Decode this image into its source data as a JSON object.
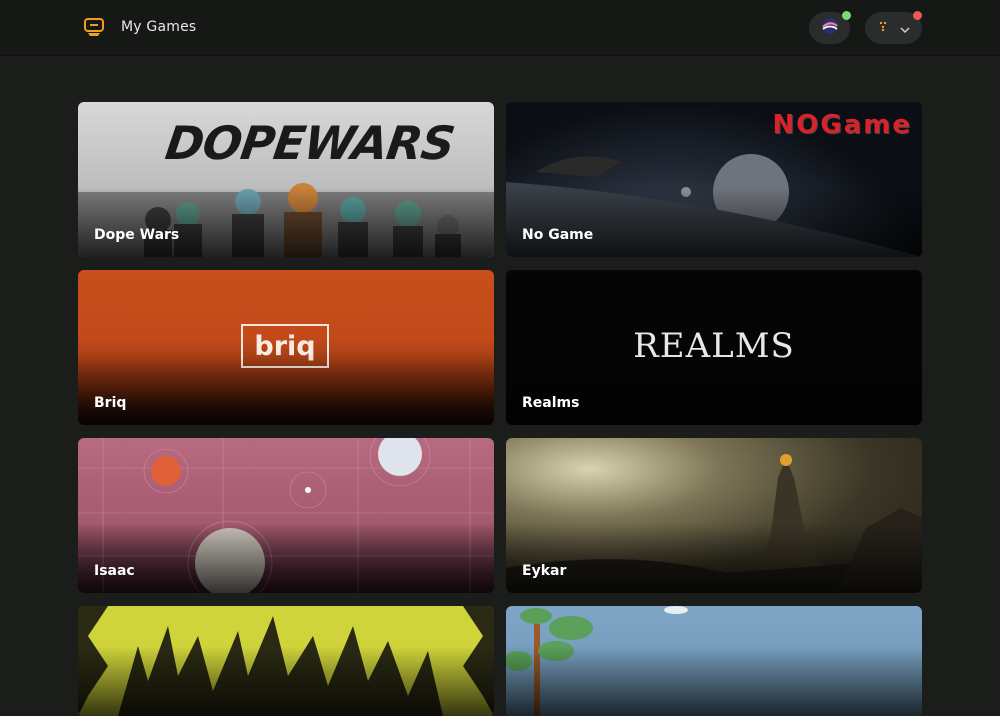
{
  "header": {
    "title": "My Games",
    "brand_icon": "controller-icon",
    "network_icon": "starknet-icon",
    "account_icon": "wallet-icon",
    "colors": {
      "accent": "#f0a020",
      "status_green": "#7ed67e",
      "status_red": "#e85a5a"
    }
  },
  "games": [
    {
      "name": "Dope Wars",
      "logo_text": "DOPEWARS"
    },
    {
      "name": "No Game",
      "logo_text": "NOGame"
    },
    {
      "name": "Briq",
      "logo_text": "briq"
    },
    {
      "name": "Realms",
      "logo_text": "REALMS"
    },
    {
      "name": "Isaac",
      "logo_text": ""
    },
    {
      "name": "Eykar",
      "logo_text": ""
    },
    {
      "name": "",
      "logo_text": ""
    },
    {
      "name": "",
      "logo_text": ""
    }
  ]
}
